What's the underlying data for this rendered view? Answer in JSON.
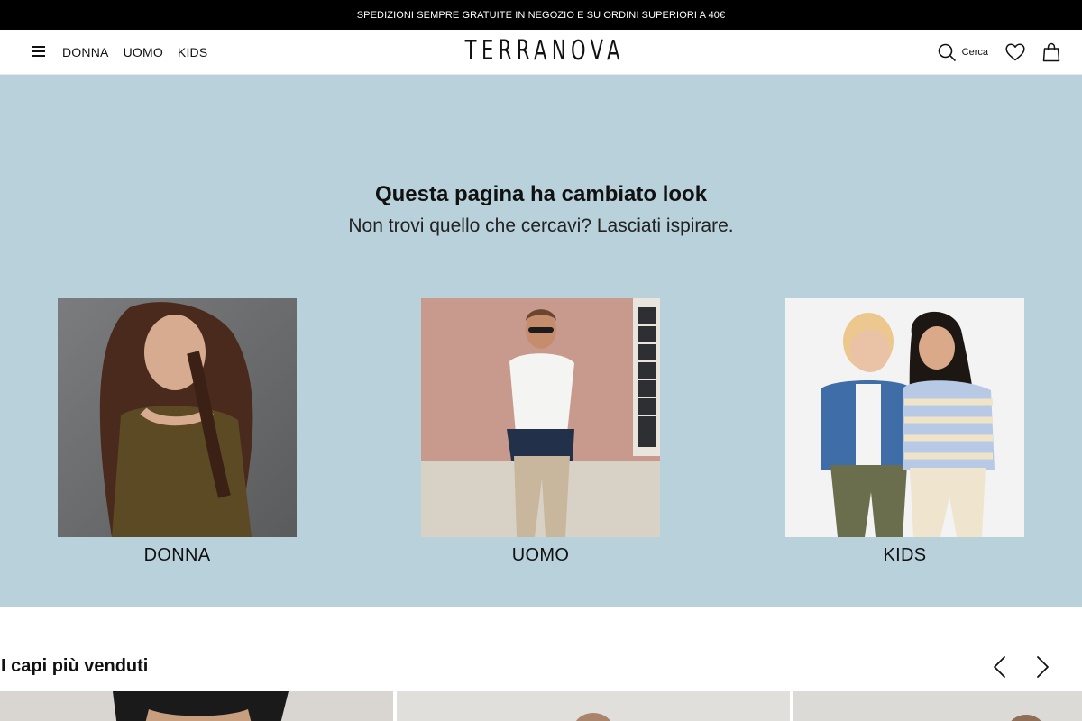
{
  "promo": {
    "text": "SPEDIZIONI SEMPRE GRATUITE  IN NEGOZIO E SU ORDINI SUPERIORI A 40€"
  },
  "header": {
    "logo": "TERRANOVA",
    "nav": [
      "DONNA",
      "UOMO",
      "KIDS"
    ],
    "search_label": "Cerca",
    "icons": {
      "menu": "hamburger-menu-icon",
      "search": "search-icon",
      "wishlist": "heart-icon",
      "cart": "shopping-bag-icon"
    }
  },
  "hero": {
    "title": "Questa pagina ha cambiato look",
    "subtitle": "Non trovi quello che cercavi? Lasciati ispirare.",
    "background": "#b8d1da",
    "categories": [
      {
        "label": "DONNA"
      },
      {
        "label": "UOMO"
      },
      {
        "label": "KIDS"
      }
    ]
  },
  "bestsellers": {
    "title": "I capi più venduti",
    "prev_icon": "chevron-left-icon",
    "next_icon": "chevron-right-icon"
  }
}
